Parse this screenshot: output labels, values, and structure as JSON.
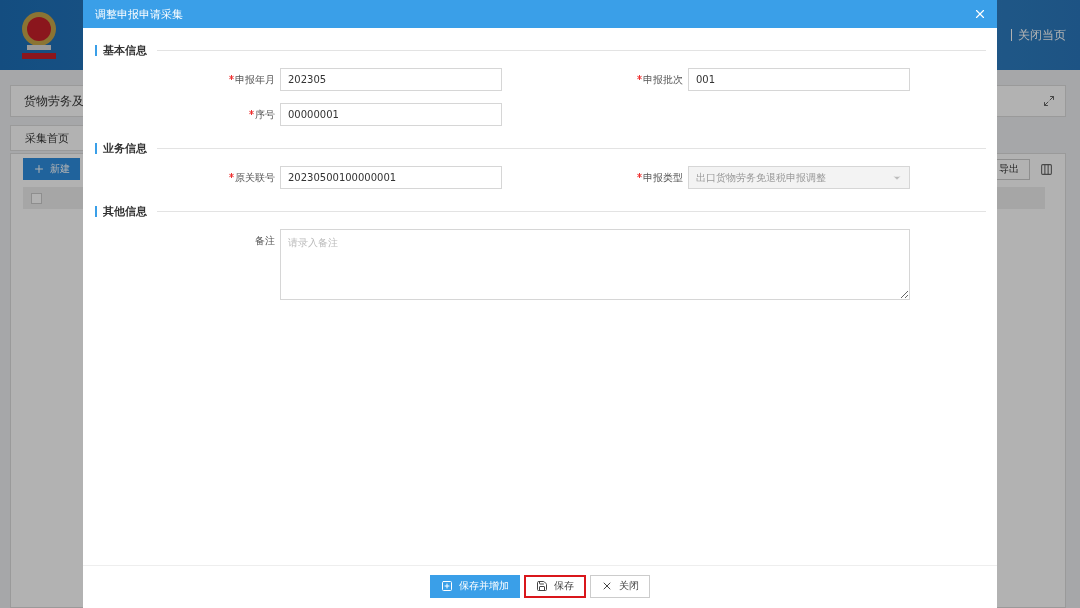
{
  "background": {
    "header_links": [
      "关闭当页"
    ],
    "select_all_checked": false,
    "breadcrumb": "货物劳务及",
    "tab": {
      "label": "采集首页",
      "selected": true
    },
    "new_button": "新建",
    "export_button": "导出"
  },
  "dialog": {
    "title": "调整申报申请采集",
    "sections": [
      {
        "title": "基本信息",
        "rows": [
          [
            {
              "kind": "input",
              "label": "申报年月",
              "required": true,
              "value": "202305"
            },
            {
              "kind": "input",
              "label": "申报批次",
              "required": true,
              "value": "001"
            }
          ],
          [
            {
              "kind": "input",
              "label": "序号",
              "required": true,
              "value": "00000001"
            }
          ]
        ]
      },
      {
        "title": "业务信息",
        "rows": [
          [
            {
              "kind": "input",
              "label": "原关联号",
              "required": true,
              "value": "20230500100000001"
            },
            {
              "kind": "select",
              "label": "申报类型",
              "required": true,
              "value": "出口货物劳务免退税申报调整",
              "disabled": true
            }
          ]
        ]
      },
      {
        "title": "其他信息",
        "rows": [
          [
            {
              "kind": "textarea",
              "label": "备注",
              "required": false,
              "placeholder": "请录入备注"
            }
          ]
        ]
      }
    ],
    "buttons": [
      {
        "kind": "primary",
        "label": "保存并增加",
        "highlighted": false
      },
      {
        "kind": "save",
        "label": "保存",
        "highlighted": true
      },
      {
        "kind": "close",
        "label": "关闭",
        "highlighted": false
      }
    ]
  }
}
